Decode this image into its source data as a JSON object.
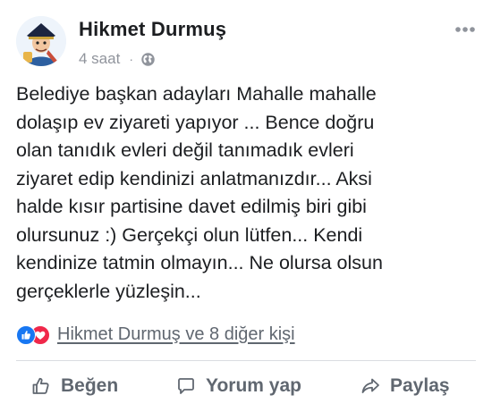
{
  "post": {
    "author": "Hikmet Durmuş",
    "time": "4 saat",
    "separator": "·",
    "privacy_icon": "globe-icon",
    "more_icon": "more-horizontal-icon",
    "text_lines": [
      "Belediye başkan adayları Mahalle mahalle",
      "dolaşıp ev ziyareti yapıyor ... Bence doğru",
      "olan tanıdık evleri değil tanımadık evleri",
      "ziyaret edip  kendinizi anlatmanızdır... Aksi",
      "halde kısır partisine davet edilmiş biri gibi",
      "olursunuz :) Gerçekçi olun lütfen... Kendi",
      "kendinize tatmin olmayın... Ne olursa olsun",
      "gerçeklerle yüzleşin..."
    ],
    "reactions": {
      "icons": [
        "like-reaction-icon",
        "love-reaction-icon"
      ],
      "summary": "Hikmet Durmuş ve 8 diğer kişi"
    },
    "actions": {
      "like": "Beğen",
      "comment": "Yorum yap",
      "share": "Paylaş"
    }
  },
  "colors": {
    "text": "#1c1e21",
    "muted": "#606770",
    "meta": "#90949c",
    "like_blue": "#1877f2",
    "love_red": "#f0284a",
    "divider": "#dadde1"
  }
}
